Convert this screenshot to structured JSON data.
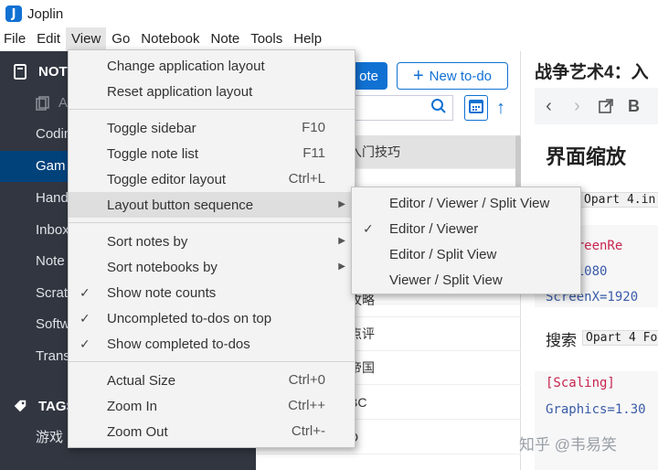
{
  "window": {
    "title": "Joplin",
    "logo_letter": "J"
  },
  "menubar": {
    "items": [
      "File",
      "Edit",
      "View",
      "Go",
      "Notebook",
      "Note",
      "Tools",
      "Help"
    ],
    "active": "View"
  },
  "sidebar": {
    "notebooks_heading": "NOTEBOOKS",
    "notebooks_heading_visible": "NOTE",
    "items": [
      {
        "label": "A",
        "dim": true
      },
      {
        "label": "Codin"
      },
      {
        "label": "Gam",
        "selected": true
      },
      {
        "label": "Hand"
      },
      {
        "label": "Inbox"
      },
      {
        "label": "Note"
      },
      {
        "label": "Scrat"
      },
      {
        "label": "Softw"
      },
      {
        "label": "Trans"
      }
    ],
    "tags_heading": "TAGS",
    "tags_heading_visible": "TAGS",
    "tag_item": "游戏"
  },
  "notelist": {
    "new_note_label": "ote",
    "new_todo_label": "New to-do",
    "new_todo_icon": "+",
    "rows": [
      {
        "title": "入门技巧",
        "selected": true
      },
      {
        "title": ""
      },
      {
        "title": ""
      },
      {
        "title": ""
      },
      {
        "title": ""
      },
      {
        "title": "攻略"
      },
      {
        "title": "点评"
      },
      {
        "title": "帝国"
      },
      {
        "title": "BC"
      },
      {
        "title": "D"
      }
    ]
  },
  "editor": {
    "title": "战争艺术4：入",
    "heading": "界面缩放",
    "inline_code_1": "Opart 4.in",
    "code_lines": [
      "geScreenRe",
      "enY=1080",
      "ScreenX=1920"
    ],
    "search_label": "搜索",
    "inline_code_2": "Opart 4 Fo",
    "scaling_section": "[Scaling]",
    "scaling_value": "Graphics=1.30",
    "toolbar_last_letter": "B"
  },
  "watermark": "知乎 @韦易笑",
  "view_menu": {
    "items": [
      {
        "label": "Change application layout"
      },
      {
        "label": "Reset application layout"
      },
      {
        "label": "Toggle sidebar",
        "accel": "F10"
      },
      {
        "label": "Toggle note list",
        "accel": "F11"
      },
      {
        "label": "Toggle editor layout",
        "accel": "Ctrl+L"
      },
      {
        "label": "Layout button sequence",
        "submenu": true,
        "hover": true
      },
      {
        "label": "Sort notes by",
        "submenu": true
      },
      {
        "label": "Sort notebooks by",
        "submenu": true
      },
      {
        "label": "Show note counts",
        "checked": true
      },
      {
        "label": "Uncompleted to-dos on top",
        "checked": true
      },
      {
        "label": "Show completed to-dos",
        "checked": true
      },
      {
        "label": "Actual Size",
        "accel": "Ctrl+0"
      },
      {
        "label": "Zoom In",
        "accel": "Ctrl++"
      },
      {
        "label": "Zoom Out",
        "accel": "Ctrl+-"
      }
    ],
    "check_glyph": "✓",
    "submenu_glyph": "▶"
  },
  "layout_submenu": {
    "items": [
      {
        "label": "Editor / Viewer / Split View",
        "checked": false
      },
      {
        "label": "Editor / Viewer",
        "checked": true
      },
      {
        "label": "Editor / Split View",
        "checked": false
      },
      {
        "label": "Viewer / Split View",
        "checked": false
      }
    ]
  },
  "colors": {
    "sidebar_bg": "#313640",
    "sidebar_selected": "#01427b",
    "accent": "#1071d3",
    "menu_bg": "#f3f3f3",
    "code_red": "#c7254e",
    "code_blue": "#3a5ca8"
  }
}
